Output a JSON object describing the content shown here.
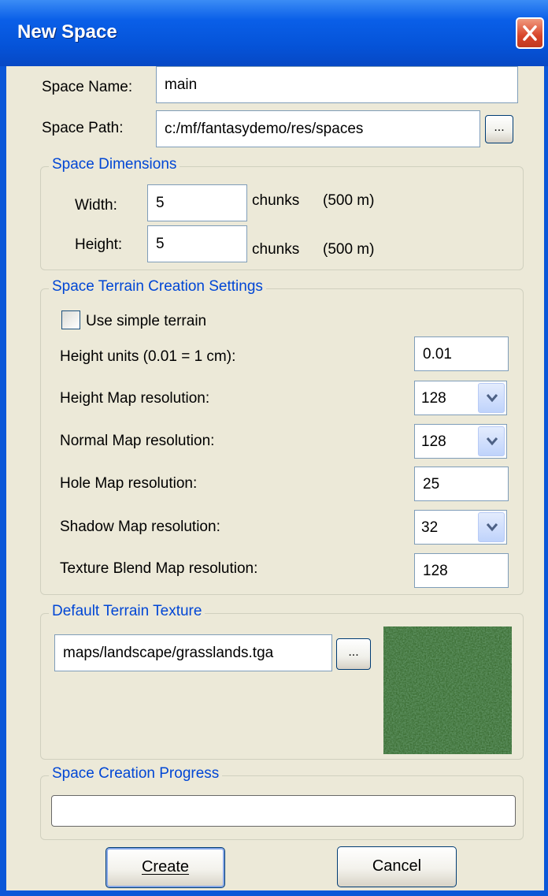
{
  "window": {
    "title": "New Space"
  },
  "space": {
    "name_label": "Space Name:",
    "name_value": "main",
    "path_label": "Space Path:",
    "path_value": "c:/mf/fantasydemo/res/spaces",
    "browse_label": "..."
  },
  "dimensions": {
    "title": "Space Dimensions",
    "width_label": "Width:",
    "width_value": "5",
    "width_unit": "chunks",
    "width_meters": "(500 m)",
    "height_label": "Height:",
    "height_value": "5",
    "height_unit": "chunks",
    "height_meters": "(500 m)"
  },
  "terrain": {
    "title": "Space Terrain Creation Settings",
    "simple_terrain_label": "Use simple terrain",
    "simple_terrain_checked": false,
    "height_units_label": "Height units (0.01 = 1 cm):",
    "height_units_value": "0.01",
    "height_map_label": "Height Map resolution:",
    "height_map_value": "128",
    "normal_map_label": "Normal Map resolution:",
    "normal_map_value": "128",
    "hole_map_label": "Hole Map resolution:",
    "hole_map_value": "25",
    "shadow_map_label": "Shadow Map resolution:",
    "shadow_map_value": "32",
    "texture_blend_label": "Texture Blend Map resolution:",
    "texture_blend_value": "128"
  },
  "texture": {
    "title": "Default Terrain Texture",
    "path_value": "maps/landscape/grasslands.tga",
    "browse_label": "..."
  },
  "progress": {
    "title": "Space Creation Progress",
    "value": 0
  },
  "buttons": {
    "create_label": "Create",
    "cancel_label": "Cancel"
  },
  "colors": {
    "title_bar": "#0553d8",
    "dialog_bg": "#ece9d8",
    "group_title": "#0046d5",
    "close_button": "#d8452a"
  }
}
